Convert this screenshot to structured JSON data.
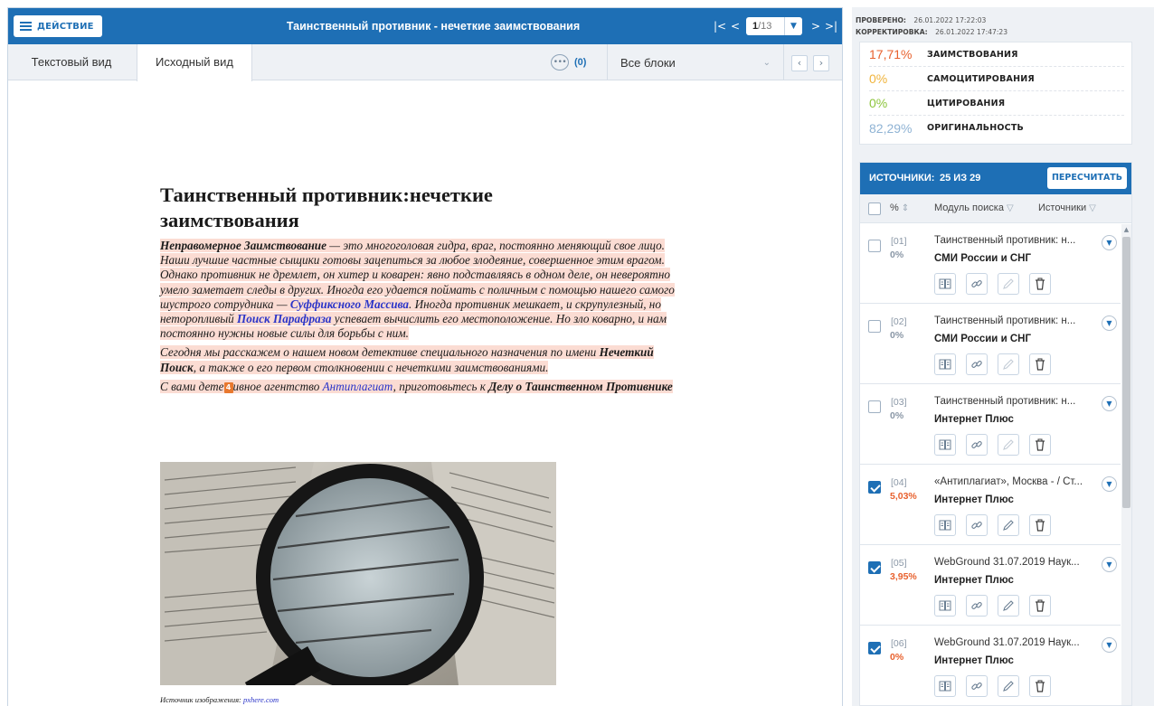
{
  "toolbar": {
    "action_label": "ДЕЙСТВИЕ",
    "doc_title": "Таинственный противник - нечеткие заимствования",
    "nav_first": "|<",
    "nav_prev": "<",
    "page_current": "1",
    "page_total": "/13",
    "nav_next": ">",
    "nav_last": ">|"
  },
  "tabs": {
    "text_view": "Текстовый вид",
    "source_view": "Исходный вид",
    "comments_count": "(0)",
    "blocks_select": "Все блоки"
  },
  "document": {
    "heading": "Таинственный противник:нечеткие заимствования",
    "p1_term": "Неправомерное Заимствование",
    "p1_text_a": " — это многоголовая гидра, враг, постоянно меняющий свое лицо. Наши лучшие частные сыщики готовы зацепиться за любое злодеяние, совершенное этим врагом. Однако противник не дремлет, он хитер и коварен: явно подставляясь в одном деле, он невероятно умело заметает следы в других. Иногда его удается поймать с поличным с помощью нашего самого шустрого сотрудника — ",
    "p1_link1": "Суффиксного Массива",
    "p1_text_b": ". Иногда противник мешкает, и скрупулезный, но неторопливый ",
    "p1_link2": "Поиск Парафраза",
    "p1_text_c": " успевает вычислить его местоположение. Но зло коварно, и нам постоянно нужны новые силы для борьбы с ним.",
    "p2_text_a": "Сегодня мы расскажем о нашем новом детективе специального назначения по имени ",
    "p2_term": "Нечеткий Поиск",
    "p2_text_b": ", а также о его первом столкновении с нечеткими заимствованиями.",
    "p3_text_a": "С вами дете",
    "p3_marker": "4",
    "p3_text_b": "ивное агентство ",
    "p3_link": "Антиплагиат",
    "p3_text_c": ", приготовьтесь к ",
    "p3_term": "Делу о Таинственном Противнике",
    "caption_label": "Источник изображения: ",
    "caption_url": "pxhere.com"
  },
  "check_info": {
    "checked_label": "ПРОВЕРЕНО:",
    "checked_value": "26.01.2022 17:22:03",
    "corrected_label": "КОРРЕКТИРОВКА:",
    "corrected_value": "26.01.2022 17:47:23"
  },
  "scores": [
    {
      "value": "17,71%",
      "label": "ЗАИМСТВОВАНИЯ",
      "color": "#e8612e"
    },
    {
      "value": "0%",
      "label": "САМОЦИТИРОВАНИЯ",
      "color": "#f0b43c"
    },
    {
      "value": "0%",
      "label": "ЦИТИРОВАНИЯ",
      "color": "#8cc43c"
    },
    {
      "value": "82,29%",
      "label": "ОРИГИНАЛЬНОСТЬ",
      "color": "#8fb3d4"
    }
  ],
  "sources": {
    "title": "ИСТОЧНИКИ:",
    "count": "25 ИЗ 29",
    "recalc_label": "ПЕРЕСЧИТАТЬ",
    "col_percent": "%",
    "col_module": "Модуль поиска",
    "col_sources": "Источники",
    "items": [
      {
        "index": "[01]",
        "percent": "0%",
        "name": "Таинственный противник: н...",
        "module": "СМИ России и СНГ",
        "checked": false
      },
      {
        "index": "[02]",
        "percent": "0%",
        "name": "Таинственный противник: н...",
        "module": "СМИ России и СНГ",
        "checked": false
      },
      {
        "index": "[03]",
        "percent": "0%",
        "name": "Таинственный противник: н...",
        "module": "Интернет Плюс",
        "checked": false
      },
      {
        "index": "[04]",
        "percent": "5,03%",
        "name": "«Антиплагиат», Москва - / Ст...",
        "module": "Интернет Плюс",
        "checked": true
      },
      {
        "index": "[05]",
        "percent": "3,95%",
        "name": "WebGround 31.07.2019 Наук...",
        "module": "Интернет Плюс",
        "checked": true
      },
      {
        "index": "[06]",
        "percent": "0%",
        "name": "WebGround 31.07.2019 Наук...",
        "module": "Интернет Плюс",
        "checked": true
      }
    ]
  },
  "colors": {
    "accent": "#1e6fb5",
    "highlight": "#fbdcd3",
    "link": "#2a34c8",
    "marker": "#e8782e"
  },
  "icons": {
    "action_menu": "hamburger-icon",
    "comments": "chat-bubble-icon",
    "item_actions": [
      "book-icon",
      "link-icon",
      "pencil-icon",
      "trash-icon"
    ],
    "expand": "chevron-down-icon",
    "filter": "funnel-icon",
    "sort": "sort-arrows-icon"
  }
}
